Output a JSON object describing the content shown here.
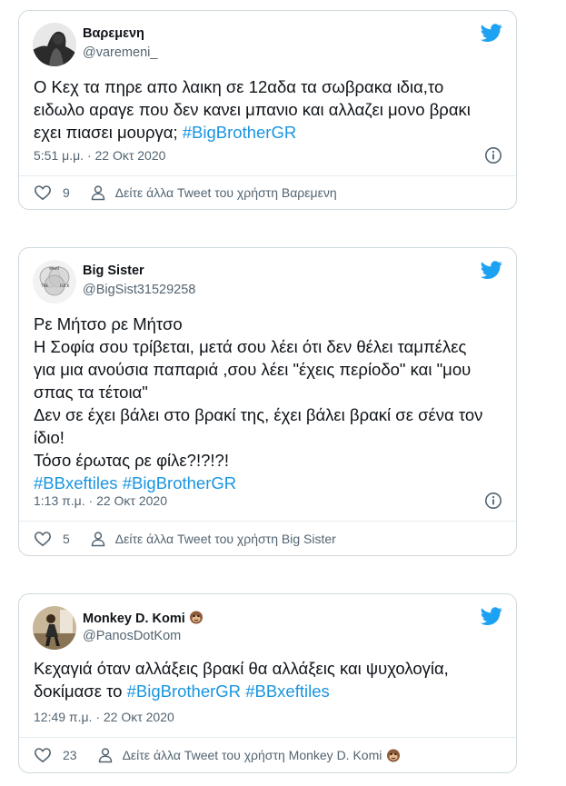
{
  "colors": {
    "hashtag": "#1b95e0",
    "twitter_blue": "#1da1f2",
    "muted": "#536471"
  },
  "icons": [
    "twitter-bird-icon",
    "info-icon",
    "heart-icon",
    "user-icon",
    "monkey-face-icon"
  ],
  "tweets": [
    {
      "name": "Βαρεμενη",
      "handle": "@varemeni_",
      "lines": [
        [
          {
            "text": "Ο Κεχ τα πηρε απο λαικη σε 12αδα τα σωβρακα ιδια,το"
          }
        ],
        [
          {
            "text": "ειδωλο αραγε που δεν κανει μπανιο και αλλαζει μονο βρακι"
          }
        ],
        [
          {
            "text": "εχει πιασει μουργα; "
          },
          {
            "text": "#BigBrotherGR",
            "tag": true
          }
        ]
      ],
      "time": "5:51 μ.μ. · 22 Οκτ 2020",
      "likes": "9",
      "more_label": "Δείτε άλλα Tweet του χρήστη Βαρεμενη"
    },
    {
      "name": "Big Sister",
      "handle": "@BigSist31529258",
      "lines": [
        [
          {
            "text": "Ρε Μήτσο ρε Μήτσο"
          }
        ],
        [
          {
            "text": "Η Σοφία σου τρίβεται, μετά σου λέει ότι δεν θέλει ταμπέλες"
          }
        ],
        [
          {
            "text": "για μια ανούσια παπαριά ,σου λέει \"έχεις περίοδο\" και \"μου"
          }
        ],
        [
          {
            "text": "σπας τα τέτοια\""
          }
        ],
        [
          {
            "text": "Δεν σε έχει βάλει στο βρακί της, έχει βάλει βρακί σε σένα τον"
          }
        ],
        [
          {
            "text": "ίδιο!"
          }
        ],
        [
          {
            "text": "Τόσο έρωτας ρε φίλε?!?!?!"
          }
        ],
        [
          {
            "text": "#BBxeftiles",
            "tag": true
          },
          {
            "text": " "
          },
          {
            "text": "#BigBrotherGR",
            "tag": true
          }
        ]
      ],
      "time": "1:13 π.μ. · 22 Οκτ 2020",
      "likes": "5",
      "more_label": "Δείτε άλλα Tweet του χρήστη Big Sister",
      "avatar_text": [
        "WHAT",
        "THE",
        "FUCK"
      ]
    },
    {
      "name": "Monkey D. Komi",
      "handle": "@PanosDotKom",
      "lines": [
        [
          {
            "text": "Κεχαγιά όταν αλλάξεις βρακί θα αλλάξεις και ψυχολογία,"
          }
        ],
        [
          {
            "text": "δοκίμασε το "
          },
          {
            "text": "#BigBrotherGR",
            "tag": true
          },
          {
            "text": " "
          },
          {
            "text": "#BBxeftiles",
            "tag": true
          }
        ]
      ],
      "time": "12:49 π.μ. · 22 Οκτ 2020",
      "likes": "23",
      "more_label": "Δείτε άλλα Tweet του χρήστη Monkey D. Komi"
    }
  ]
}
